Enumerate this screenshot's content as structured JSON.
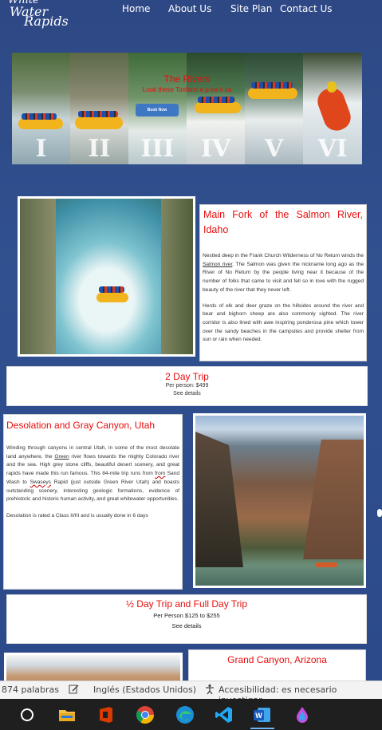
{
  "nav": {
    "logo": [
      "White",
      "Water",
      "Rapids"
    ],
    "links": [
      "Home",
      "About Us",
      "Site Plan",
      "Contact Us"
    ]
  },
  "banner": {
    "title": "The Rivers",
    "subtitle": "Look these Tonforst e p ea  h ca",
    "button": "Book Now",
    "classes": [
      "I",
      "II",
      "III",
      "IV",
      "V",
      "VI"
    ]
  },
  "salmon": {
    "title": "Main Fork of the Salmon River, Idaho",
    "p1_before": "Nestled deep in the Frank Church Wilderness of No Return winds the ",
    "p1_link": "Salmon river",
    "p1_after": ". The Salmon was given the nickname long ago as the River of No Return by the people living near it because of the number of folks that came to visit and fell so in love with the rugged beauty of the river that they never left.",
    "p2": "Herds of elk and deer graze on the hillsides around the river and bear and bighorn sheep are also commonly sighted. The river corridor is also lined with awe inspiring ponderosa pine which tower over the sandy beaches in the campsites and provide shelter from sun or rain when needed.",
    "trip_title": "2 Day Trip",
    "trip_price": "Per person: $499",
    "trip_link": "See details"
  },
  "desolation": {
    "title": "Desolation and Gray Canyon, Utah",
    "p1_a": "Winding through canyons in central Utah, in some of the most desolate land anywhere, the ",
    "p1_green": "Green",
    "p1_b": " river flows towards the mighty Colorado river and the sea. High grey stone cliffs, beautiful desert scenery, and great rapids have made this run famous. This 84-mile trip runs from ",
    "p1_from": "from",
    "p1_c": " Sand Wash to ",
    "p1_swasey": "Swaseys",
    "p1_d": " Rapid (just outside Green River Utah) and boasts outstanding scenery, interesting geologic formations, evidence of prehistoric and historic human activity, and great whitewater opportunities.",
    "p2": "Desolation is rated a Class II/III and is usually done in 6 days",
    "trip_title": "½ Day Trip and Full Day Trip",
    "trip_price": "Per Person $125 to $255",
    "trip_link": "See details"
  },
  "grand": {
    "title": "Grand Canyon, Arizona"
  },
  "statusbar": {
    "words": "874 palabras",
    "language": "Inglés (Estados Unidos)",
    "accessibility": "Accesibilidad: es necesario investigar"
  },
  "taskbar": {
    "icons": [
      "search-circle-icon",
      "file-explorer-icon",
      "office-icon",
      "chrome-icon",
      "edge-icon",
      "vscode-icon",
      "word-icon",
      "paint-icon"
    ]
  },
  "colors": {
    "accent_red": "#e80d0d",
    "page_blue": "#2e4885"
  }
}
